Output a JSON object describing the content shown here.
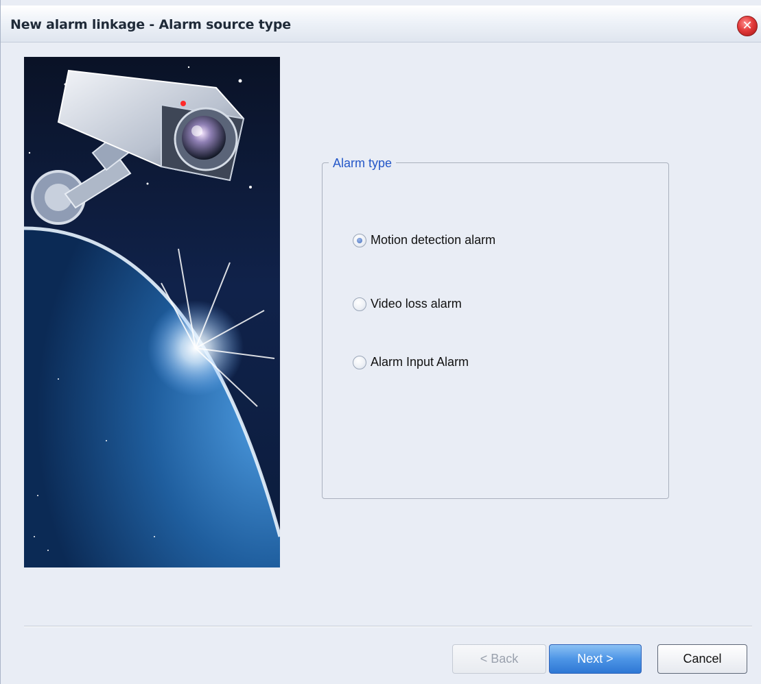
{
  "window": {
    "title": "New alarm linkage  -  Alarm source type",
    "close_icon": "close-icon"
  },
  "group": {
    "legend": "Alarm type",
    "options": [
      {
        "label": "Motion detection alarm",
        "selected": true
      },
      {
        "label": "Video loss alarm",
        "selected": false
      },
      {
        "label": "Alarm Input Alarm",
        "selected": false
      }
    ]
  },
  "buttons": {
    "back": "< Back",
    "next": "Next >",
    "cancel": "Cancel",
    "back_enabled": false
  },
  "colors": {
    "accent": "#2457c8",
    "next_button": "#4d95e6",
    "close_button": "#e23a3a"
  }
}
